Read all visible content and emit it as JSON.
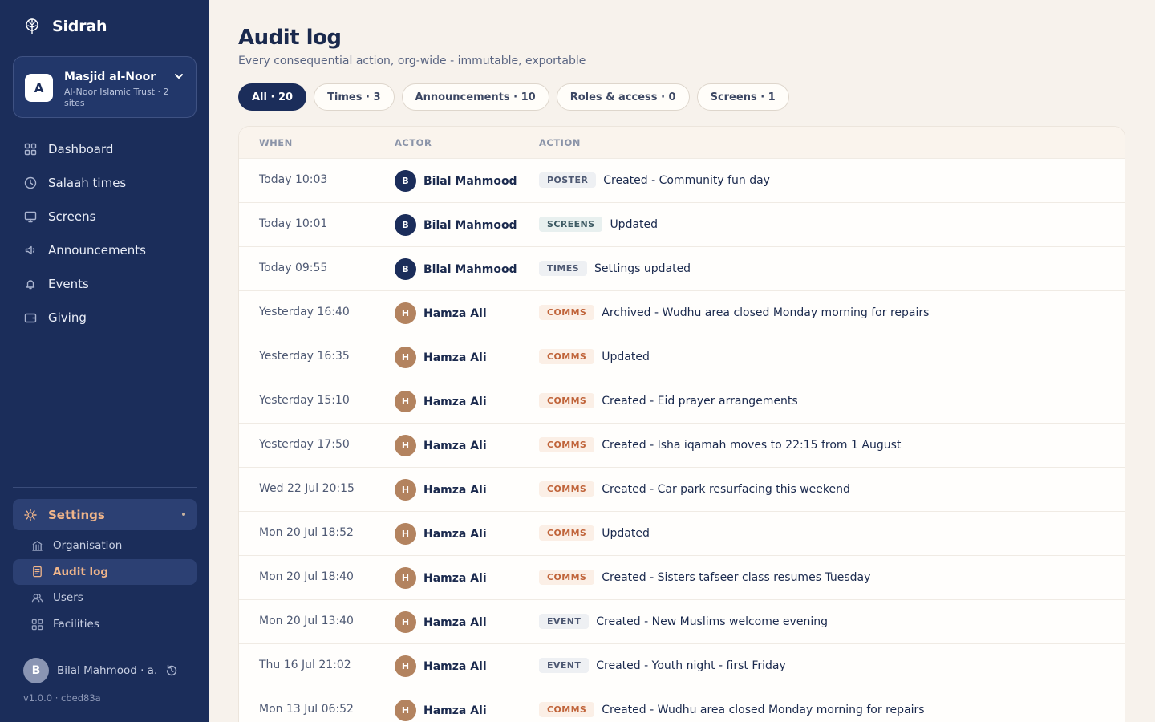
{
  "colors": {
    "sidebar_bg": "#1b2d5a",
    "accent": "#f0b58a",
    "page_bg": "#f7f2ec",
    "avatar_navy": "#1b2d5a",
    "avatar_tan": "#b3835f",
    "comms_tag": "#c0643a"
  },
  "brand": {
    "name": "Sidrah",
    "icon": "tree-icon"
  },
  "org": {
    "avatar_letter": "A",
    "name": "Masjid al-Noor",
    "subtitle": "Al-Noor Islamic Trust · 2 sites",
    "icon": "chevron-down-icon"
  },
  "nav": [
    {
      "label": "Dashboard",
      "icon": "grid-icon"
    },
    {
      "label": "Salaah times",
      "icon": "clock-icon"
    },
    {
      "label": "Screens",
      "icon": "monitor-icon"
    },
    {
      "label": "Announcements",
      "icon": "megaphone-icon"
    },
    {
      "label": "Events",
      "icon": "bell-icon"
    },
    {
      "label": "Giving",
      "icon": "wallet-icon"
    }
  ],
  "settings": {
    "label": "Settings",
    "icon": "sun-icon",
    "items": [
      {
        "label": "Organisation",
        "icon": "building-icon"
      },
      {
        "label": "Audit log",
        "icon": "document-icon",
        "active": true
      },
      {
        "label": "Users",
        "icon": "users-icon"
      },
      {
        "label": "Facilities",
        "icon": "grid-icon"
      }
    ]
  },
  "user": {
    "avatar_letter": "B",
    "name": "Bilal Mahmood · a...",
    "icon": "refresh-icon"
  },
  "version": "v1.0.0 · cbed83a",
  "page": {
    "title": "Audit log",
    "subtitle": "Every consequential action, org-wide - immutable, exportable"
  },
  "filters": [
    {
      "label": "All · 20",
      "active": true
    },
    {
      "label": "Times · 3"
    },
    {
      "label": "Announcements · 10"
    },
    {
      "label": "Roles & access · 0"
    },
    {
      "label": "Screens · 1"
    }
  ],
  "table": {
    "headers": {
      "when": "WHEN",
      "actor": "ACTOR",
      "action": "ACTION"
    },
    "rows": [
      {
        "when": "Today 10:03",
        "avatar": "B",
        "actor": "Bilal Mahmood",
        "tag": "POSTER",
        "tag_kind": "neutral",
        "text": "Created - Community fun day"
      },
      {
        "when": "Today 10:01",
        "avatar": "B",
        "actor": "Bilal Mahmood",
        "tag": "SCREENS",
        "tag_kind": "screens",
        "text": "Updated"
      },
      {
        "when": "Today 09:55",
        "avatar": "B",
        "actor": "Bilal Mahmood",
        "tag": "TIMES",
        "tag_kind": "neutral",
        "text": "Settings updated"
      },
      {
        "when": "Yesterday 16:40",
        "avatar": "H",
        "actor": "Hamza Ali",
        "tag": "COMMS",
        "tag_kind": "comms",
        "text": "Archived - Wudhu area closed Monday morning for repairs"
      },
      {
        "when": "Yesterday 16:35",
        "avatar": "H",
        "actor": "Hamza Ali",
        "tag": "COMMS",
        "tag_kind": "comms",
        "text": "Updated"
      },
      {
        "when": "Yesterday 15:10",
        "avatar": "H",
        "actor": "Hamza Ali",
        "tag": "COMMS",
        "tag_kind": "comms",
        "text": "Created - Eid prayer arrangements"
      },
      {
        "when": "Yesterday 17:50",
        "avatar": "H",
        "actor": "Hamza Ali",
        "tag": "COMMS",
        "tag_kind": "comms",
        "text": "Created - Isha iqamah moves to 22:15 from 1 August"
      },
      {
        "when": "Wed 22 Jul 20:15",
        "avatar": "H",
        "actor": "Hamza Ali",
        "tag": "COMMS",
        "tag_kind": "comms",
        "text": "Created - Car park resurfacing this weekend"
      },
      {
        "when": "Mon 20 Jul 18:52",
        "avatar": "H",
        "actor": "Hamza Ali",
        "tag": "COMMS",
        "tag_kind": "comms",
        "text": "Updated"
      },
      {
        "when": "Mon 20 Jul 18:40",
        "avatar": "H",
        "actor": "Hamza Ali",
        "tag": "COMMS",
        "tag_kind": "comms",
        "text": "Created - Sisters tafseer class resumes Tuesday"
      },
      {
        "when": "Mon 20 Jul 13:40",
        "avatar": "H",
        "actor": "Hamza Ali",
        "tag": "EVENT",
        "tag_kind": "neutral",
        "text": "Created - New Muslims welcome evening"
      },
      {
        "when": "Thu 16 Jul 21:02",
        "avatar": "H",
        "actor": "Hamza Ali",
        "tag": "EVENT",
        "tag_kind": "neutral",
        "text": "Created - Youth night - first Friday"
      },
      {
        "when": "Mon 13 Jul 06:52",
        "avatar": "H",
        "actor": "Hamza Ali",
        "tag": "COMMS",
        "tag_kind": "comms",
        "text": "Created - Wudhu area closed Monday morning for repairs"
      }
    ]
  }
}
